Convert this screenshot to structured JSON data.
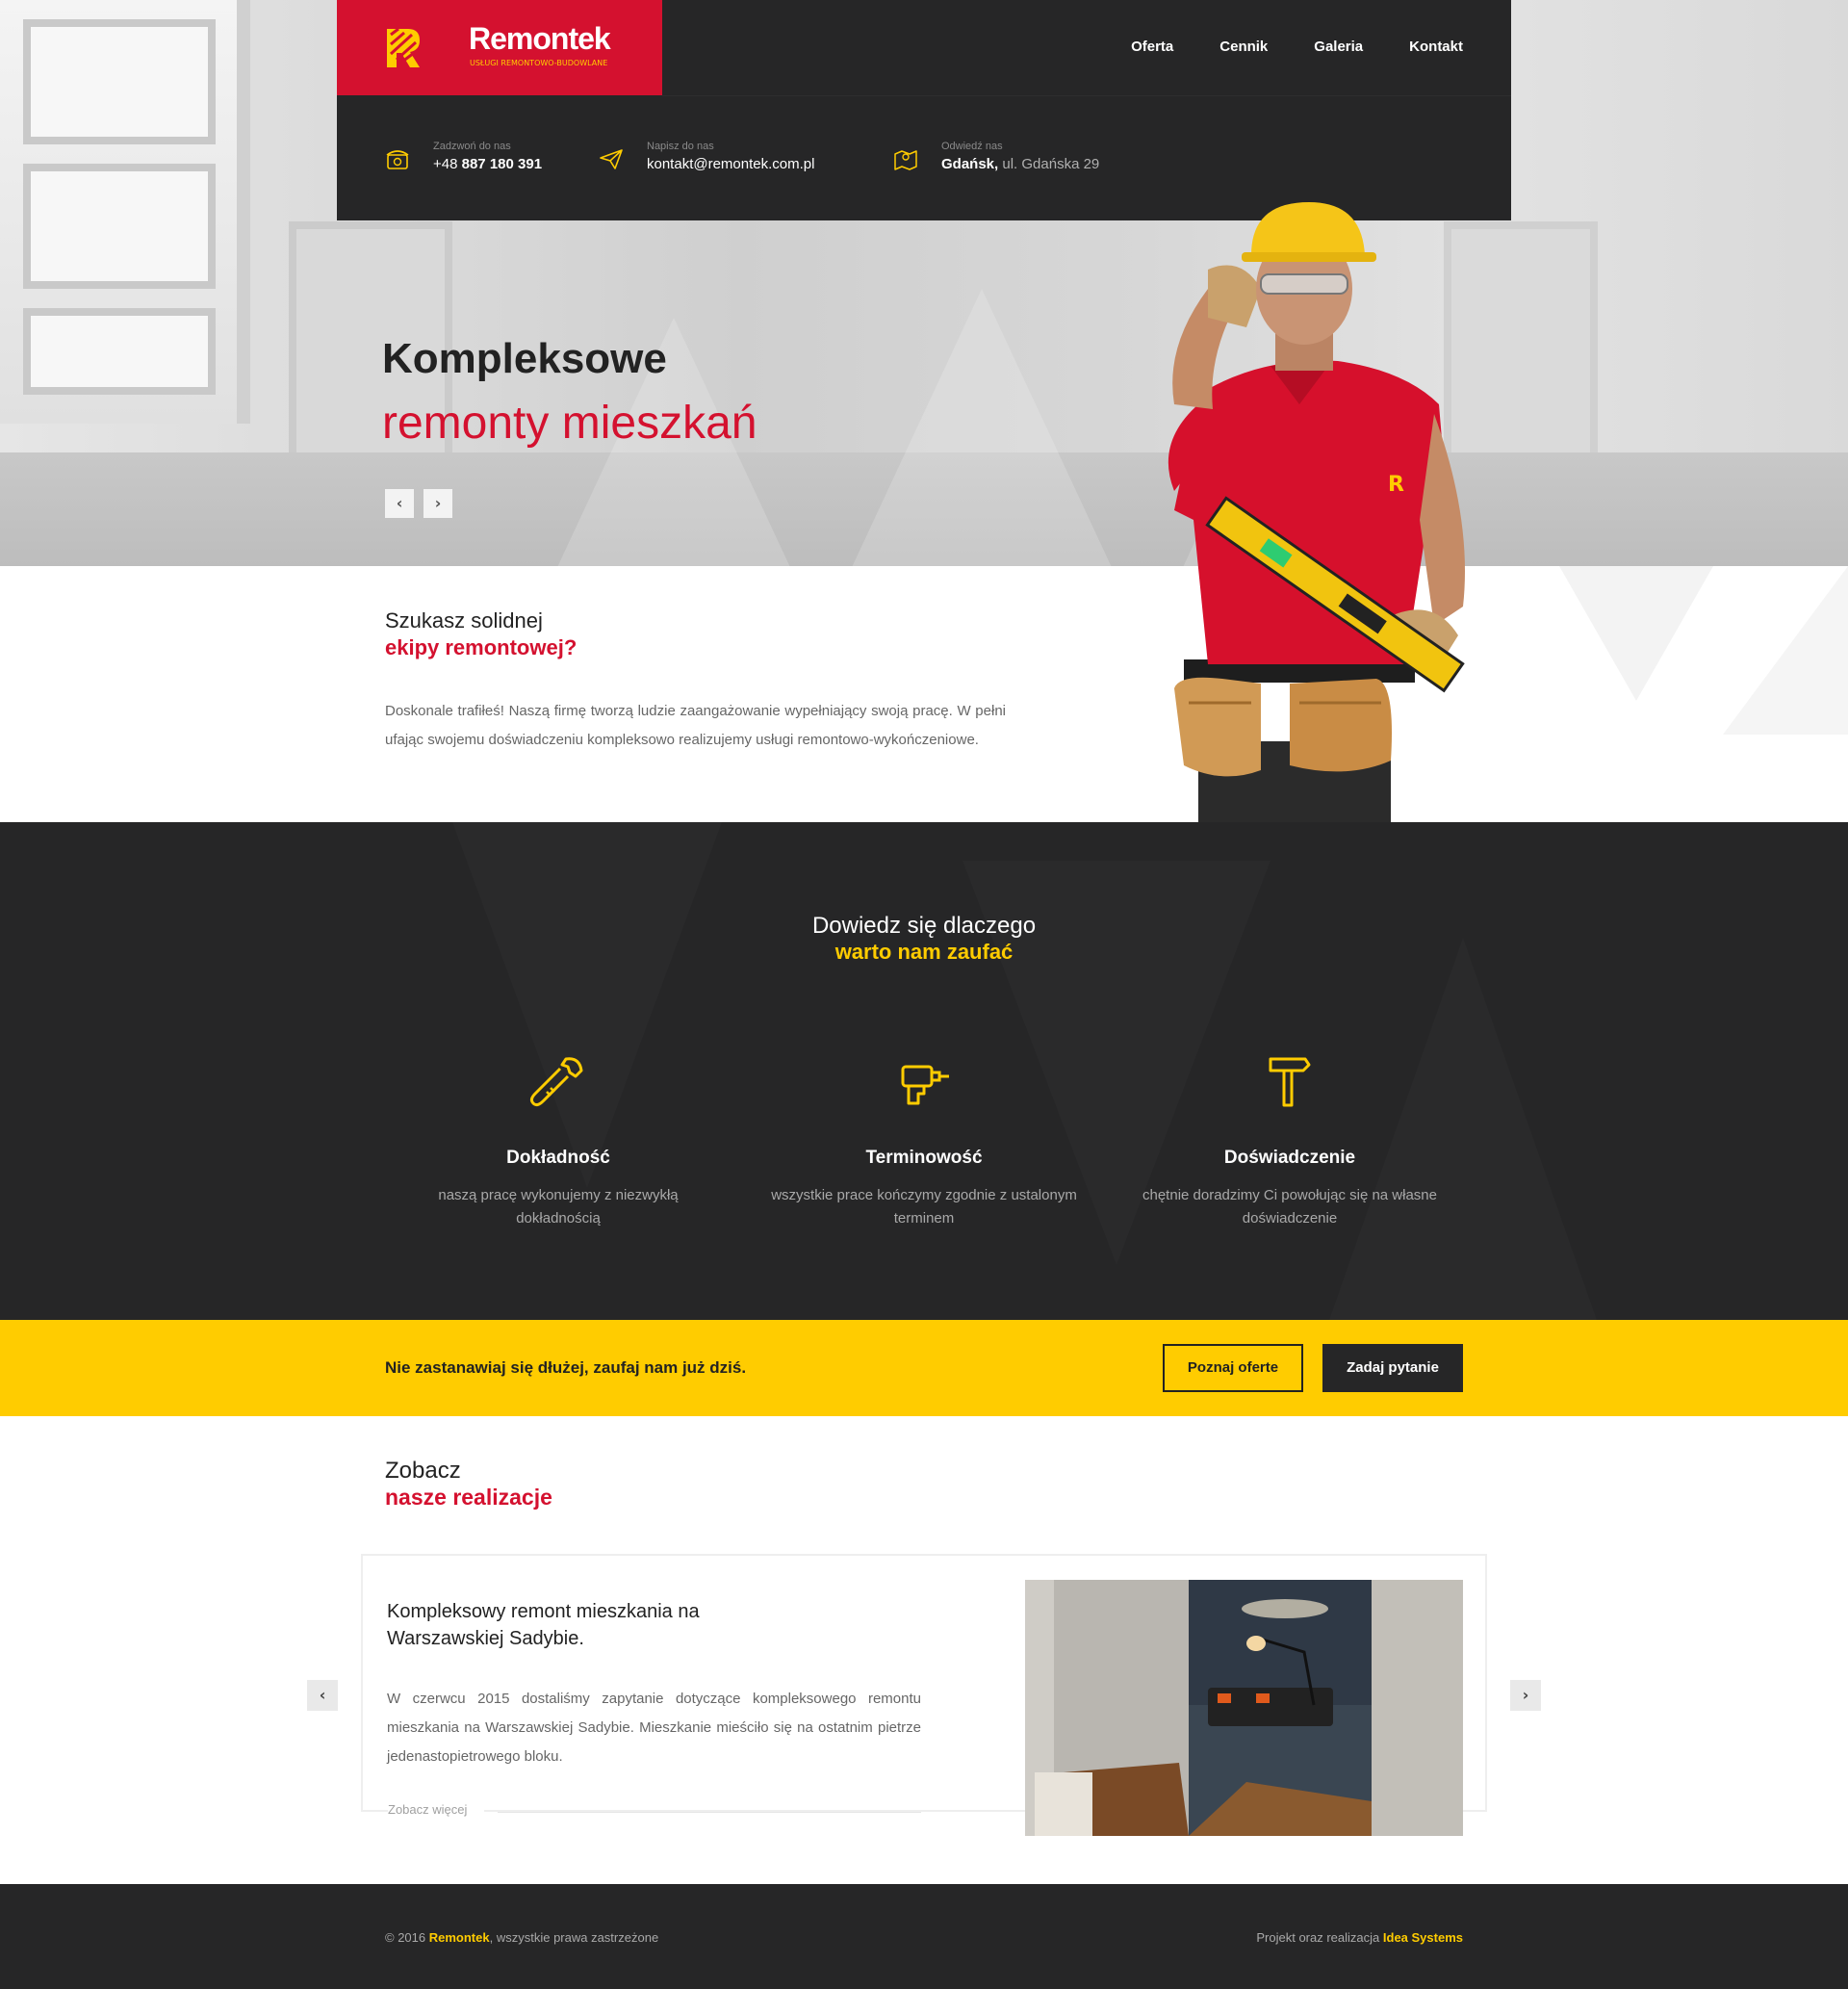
{
  "brand": {
    "name": "Remontek",
    "tagline": "USŁUGI REMONTOWO-BUDOWLANE",
    "primary_color": "#d4112f",
    "accent_color": "#ffcc00",
    "dark_color": "#262627"
  },
  "nav": {
    "items": [
      {
        "label": "Oferta"
      },
      {
        "label": "Cennik"
      },
      {
        "label": "Galeria"
      },
      {
        "label": "Kontakt"
      }
    ]
  },
  "contact": {
    "phone": {
      "label": "Zadzwoń do nas",
      "prefix": "+48",
      "number": "887 180 391",
      "icon": "phone-icon"
    },
    "email": {
      "label": "Napisz do nas",
      "value": "kontakt@remontek.com.pl",
      "icon": "paper-plane-icon"
    },
    "address": {
      "label": "Odwiedź nas",
      "city": "Gdańsk,",
      "street": "ul. Gdańska 29",
      "icon": "map-icon"
    }
  },
  "hero": {
    "title_line1": "Kompleksowe",
    "title_line2": "remonty mieszkań",
    "prev": "‹",
    "next": "›"
  },
  "intro": {
    "heading1": "Szukasz solidnej",
    "heading2": "ekipy remontowej?",
    "text": "Doskonale trafiłeś! Naszą firmę tworzą ludzie zaangażowanie wypełniający swoją pracę. W pełni ufając swojemu doświadczeniu kompleksowo realizujemy usługi remontowo-wykończeniowe."
  },
  "why": {
    "heading1": "Dowiedz się dlaczego",
    "heading2": "warto nam zaufać",
    "features": [
      {
        "title": "Dokładność",
        "desc": "naszą pracę wykonujemy z niezwykłą dokładnością",
        "icon": "wrench-icon"
      },
      {
        "title": "Terminowość",
        "desc": "wszystkie prace kończymy zgodnie z ustalonym terminem",
        "icon": "drill-icon"
      },
      {
        "title": "Doświadczenie",
        "desc": "chętnie doradzimy Ci powołując się na własne doświadczenie",
        "icon": "hammer-icon"
      }
    ]
  },
  "cta": {
    "text": "Nie zastanawiaj się dłużej, zaufaj nam już dziś.",
    "btn_offer": "Poznaj oferte",
    "btn_ask": "Zadaj pytanie"
  },
  "realizations": {
    "heading1": "Zobacz",
    "heading2": "nasze realizacje",
    "card": {
      "title": "Kompleksowy remont mieszkania na Warszawskiej Sadybie.",
      "desc": "W czerwcu 2015 dostaliśmy zapytanie dotyczące kompleksowego remontu mieszkania na Warszawskiej Sadybie. Mieszkanie mieściło się na ostatnim pietrze jedenastopietrowego bloku.",
      "more": "Zobacz więcej"
    },
    "prev": "‹",
    "next": "›"
  },
  "footer": {
    "copy_prefix": "© 2016",
    "copy_brand": "Remontek",
    "copy_suffix": ", wszystkie prawa zastrzeżone",
    "credit_prefix": "Projekt oraz realizacja",
    "credit_brand": "Idea Systems"
  }
}
